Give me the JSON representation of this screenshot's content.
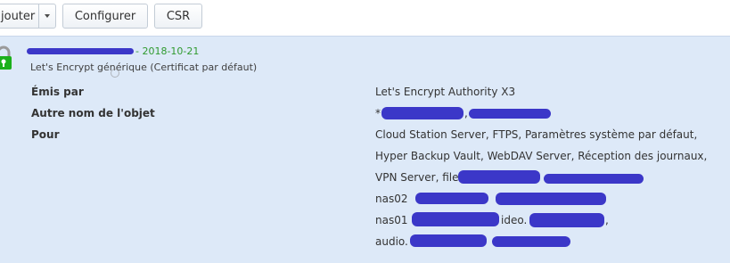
{
  "toolbar": {
    "add_label": "jouter",
    "configure_label": "Configurer",
    "csr_label": "CSR"
  },
  "certificate": {
    "expiry": "- 2018-10-21",
    "description": "Let's Encrypt générique (Certificat par défaut)",
    "details": {
      "issued_by_label": "Émis par",
      "issued_by_value": "Let's Encrypt Authority X3",
      "alt_name_label": "Autre nom de l'objet",
      "alt_name_value_visible": "*",
      "alt_name_value_suffix": ",",
      "for_label": "Pour",
      "for_values": [
        "Cloud Station Server, FTPS, Paramètres système par défaut,",
        "Hyper Backup Vault, WebDAV Server, Réception des journaux,",
        "VPN Server, file",
        "nas02",
        "nas01",
        "audio."
      ],
      "for_fragments": [
        {
          "text": "ideo."
        },
        {
          "text": ","
        }
      ]
    }
  },
  "colors": {
    "panel_bg": "#dde9f8",
    "redaction": "#3b37c8",
    "expiry_green": "#2f9a2f",
    "lock_green": "#1bb01b"
  },
  "icons": {
    "lock": "lock-icon",
    "dropdown": "chevron-down-icon"
  }
}
